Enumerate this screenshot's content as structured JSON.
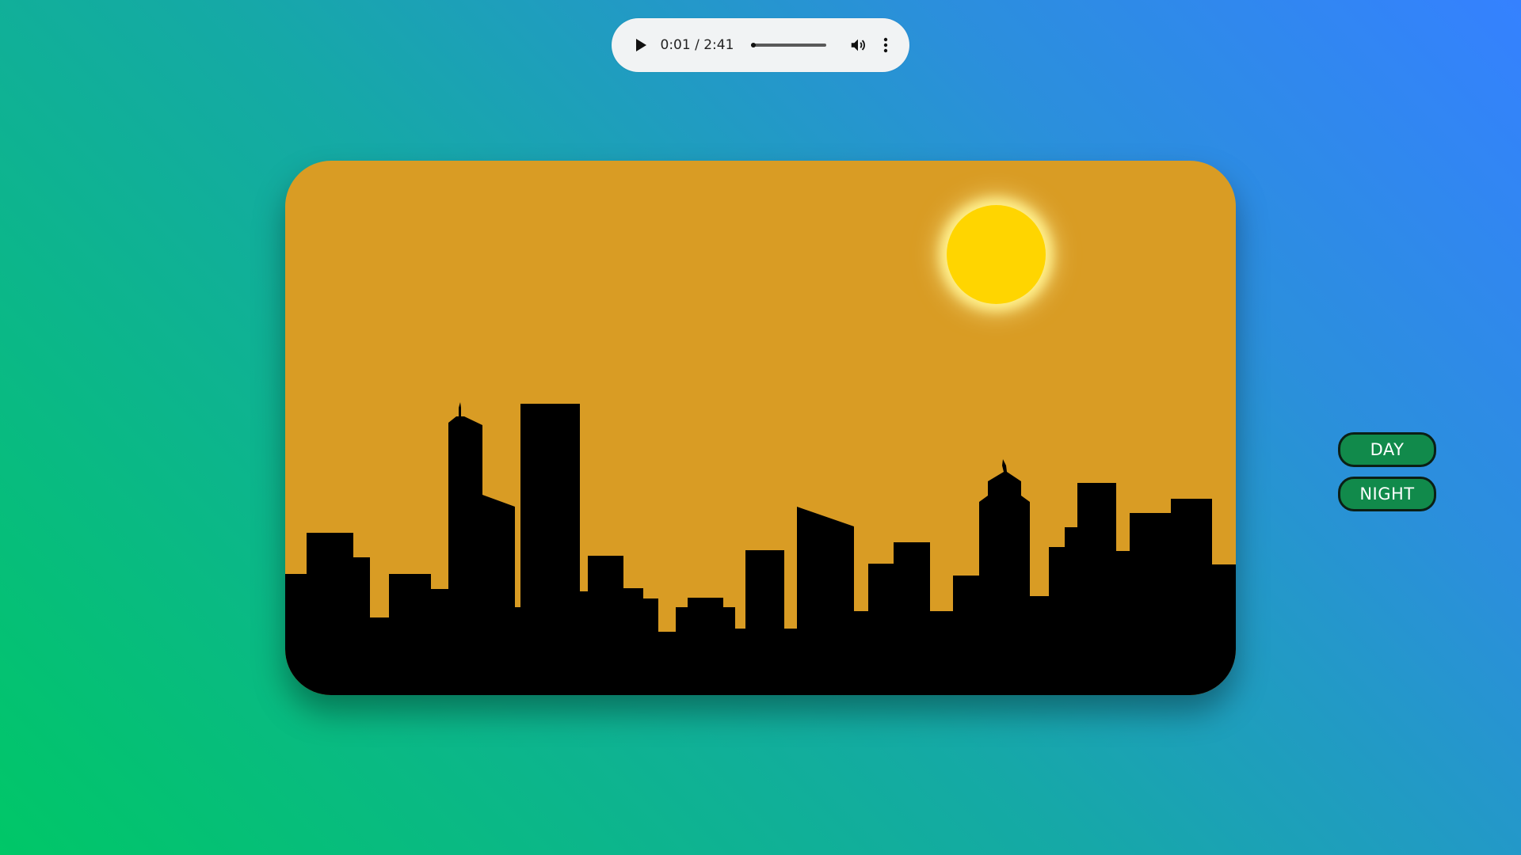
{
  "audio": {
    "current_time": "0:01",
    "separator": " / ",
    "duration": "2:41",
    "progress_fraction": 0.01,
    "play_icon": "play-icon",
    "volume_icon": "volume-icon",
    "more_icon": "more-vert-icon"
  },
  "scene": {
    "sky_color": "#d99c24",
    "sun_color": "#ffd500",
    "silhouette_color": "#000000"
  },
  "buttons": {
    "day_label": "DAY",
    "night_label": "NIGHT",
    "color": "#118a4b"
  }
}
